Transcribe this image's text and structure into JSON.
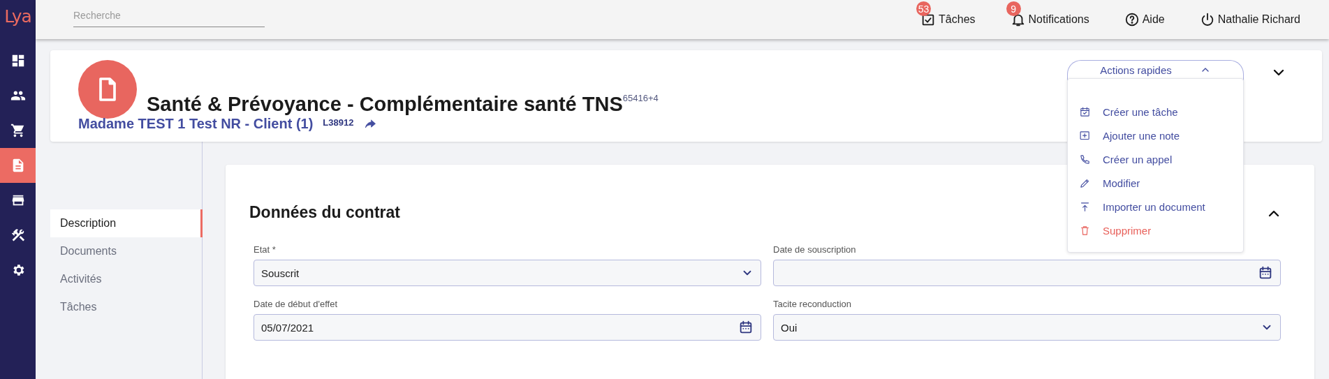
{
  "sidebar": {
    "logo": "Lya",
    "items": [
      {
        "selected": false
      },
      {
        "selected": false
      },
      {
        "selected": false
      },
      {
        "selected": true
      },
      {
        "selected": false
      },
      {
        "selected": false
      },
      {
        "selected": false
      }
    ]
  },
  "topbar": {
    "search": {
      "placeholder": "Recherche"
    },
    "items": [
      {
        "kind": "tasks",
        "label": "Tâches",
        "badge": "53"
      },
      {
        "kind": "notifications",
        "label": "Notifications",
        "badge": "9"
      },
      {
        "kind": "help",
        "label": "Aide"
      },
      {
        "kind": "logout",
        "label": "Nathalie Richard"
      }
    ]
  },
  "header": {
    "title": "Santé & Prévoyance - Complémentaire santé TNS$^{65416+4}$",
    "client": "Madame TEST 1 Test NR - Client (1)",
    "reference": "L38912",
    "expanded": false,
    "quick_actions": {
      "label": "Actions rapides",
      "expanded": true,
      "items": [
        {
          "kind": "task",
          "label": "Créer une tâche"
        },
        {
          "kind": "note",
          "label": "Ajouter une note"
        },
        {
          "kind": "call",
          "label": "Créer un appel"
        },
        {
          "kind": "edit",
          "label": "Modifier"
        },
        {
          "kind": "upload",
          "label": "Importer un document"
        },
        {
          "kind": "delete",
          "label": "Supprimer"
        }
      ]
    }
  },
  "nav": {
    "items": [
      {
        "label": "Description",
        "selected": true
      },
      {
        "label": "Documents",
        "selected": false
      },
      {
        "label": "Activités",
        "selected": false
      },
      {
        "label": "Tâches",
        "selected": false
      }
    ]
  },
  "form": {
    "title": "Données du contrat",
    "expanded": true,
    "fields": [
      {
        "kind": "select",
        "label": "Etat *",
        "value": "Souscrit"
      },
      {
        "kind": "date",
        "label": "Date de souscription"
      },
      {
        "kind": "date",
        "label": "Date de début d'effet",
        "value": "05/07/2021"
      },
      {
        "kind": "select",
        "label": "Tacite reconduction",
        "value": "Oui"
      }
    ]
  }
}
